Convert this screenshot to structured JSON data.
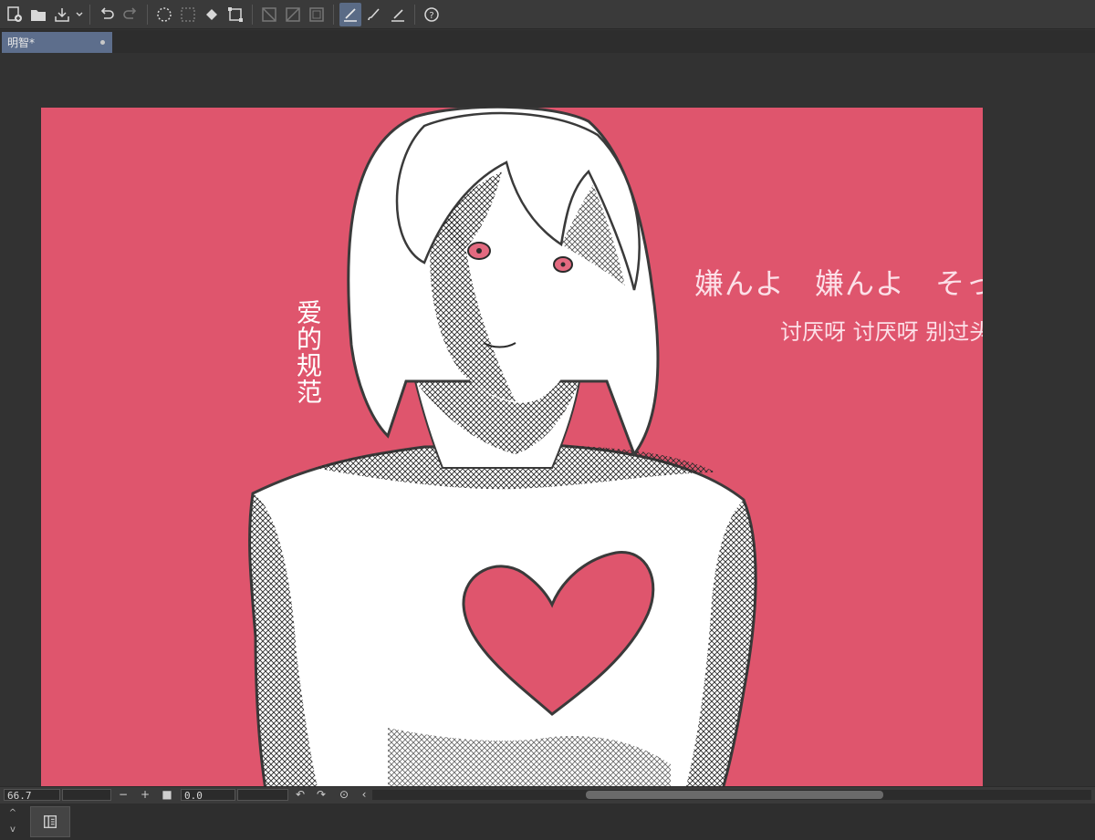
{
  "document_tab": {
    "title": "明智*"
  },
  "toolbar": {
    "icons": [
      "new-file-icon",
      "open-folder-icon",
      "save-icon",
      "undo-icon",
      "redo-icon",
      "selection-icon",
      "deselect-icon",
      "fill-icon",
      "transform-icon",
      "ruler-icon",
      "gradient-icon",
      "frame-icon",
      "pen-icon",
      "brush-icon",
      "eraser-icon",
      "help-icon"
    ]
  },
  "canvas": {
    "background_color": "#df556d",
    "vertical_text": "爱的规范",
    "lyric_japanese": "嫌んよ　嫌んよ　そっぽ向い",
    "lyric_chinese": "讨厌呀 讨厌呀 别过头去"
  },
  "statusbar": {
    "zoom": "66.7",
    "rotation": "0.0"
  }
}
